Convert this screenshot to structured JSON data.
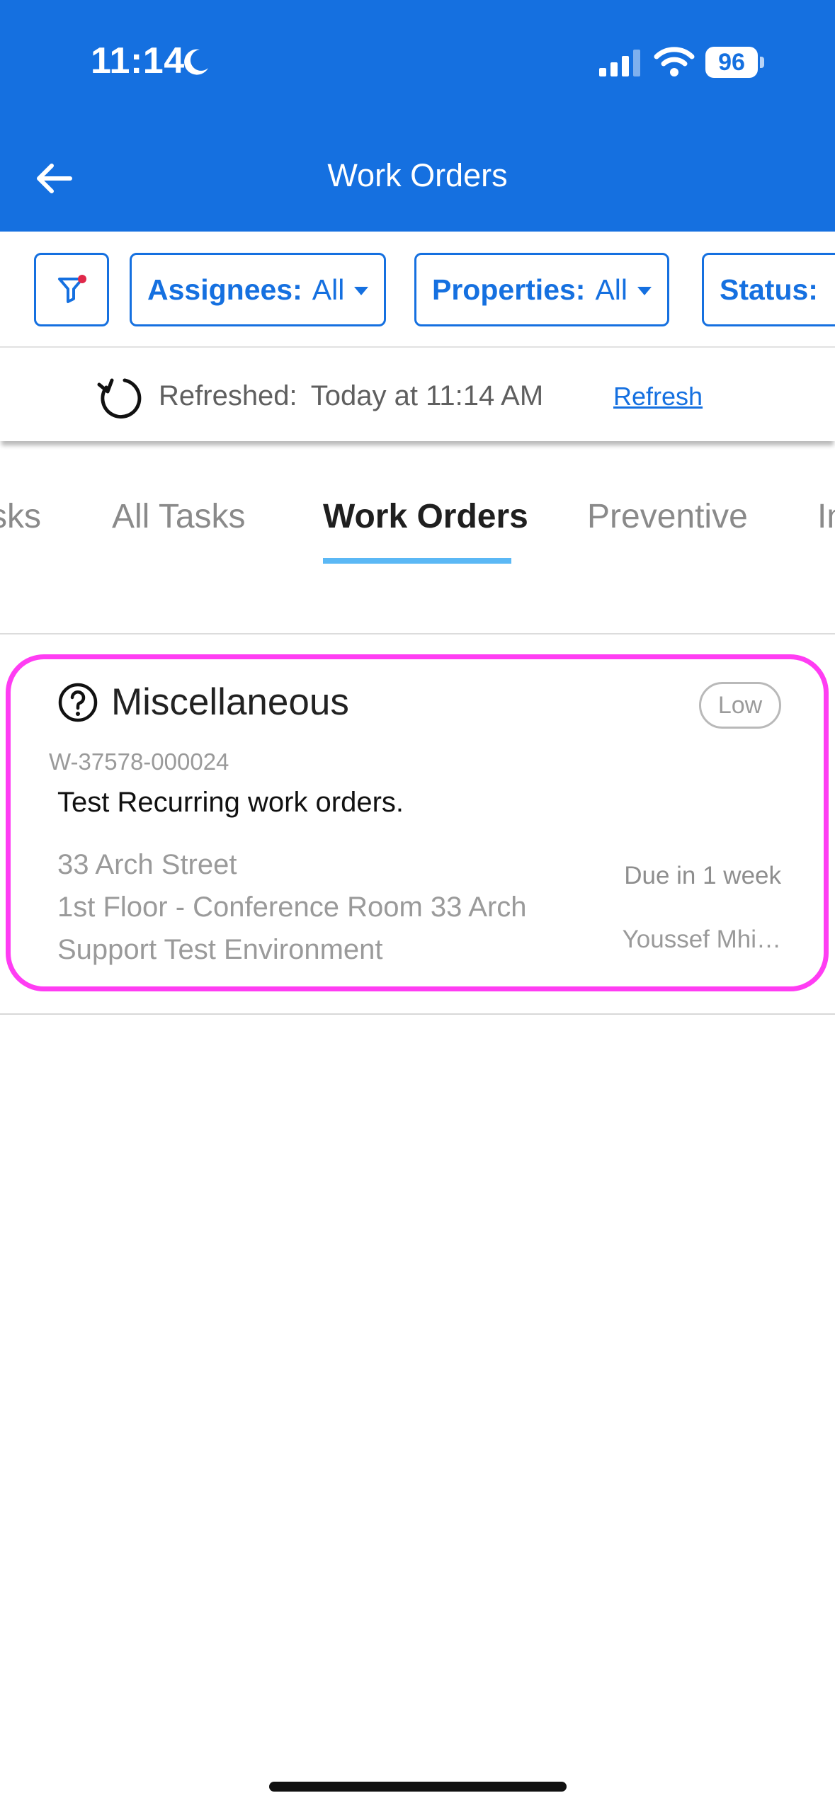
{
  "status_bar": {
    "time": "11:14",
    "battery": "96"
  },
  "nav": {
    "title": "Work Orders"
  },
  "filters": {
    "assignees": {
      "label": "Assignees:",
      "value": "All"
    },
    "properties": {
      "label": "Properties:",
      "value": "All"
    },
    "status": {
      "label": "Status:"
    }
  },
  "refresh": {
    "label": "Refreshed:",
    "value": "Today at 11:14 AM",
    "link": "Refresh"
  },
  "tabs": [
    {
      "label": "sks"
    },
    {
      "label": "All Tasks"
    },
    {
      "label": "Work Orders"
    },
    {
      "label": "Preventive"
    },
    {
      "label": "In"
    }
  ],
  "work_order": {
    "category": "Miscellaneous",
    "priority": "Low",
    "id": "W-37578-000024",
    "description": "Test Recurring work orders.",
    "address_line1": "33 Arch Street",
    "address_line2": "1st Floor - Conference Room 33 Arch",
    "address_line3": "Support Test Environment",
    "due": "Due in 1 week",
    "assignee": "Youssef Mhi…"
  },
  "colors": {
    "primary": "#1570e0",
    "highlight": "#ff3df3",
    "tab_indicator": "#5bb8f5"
  }
}
